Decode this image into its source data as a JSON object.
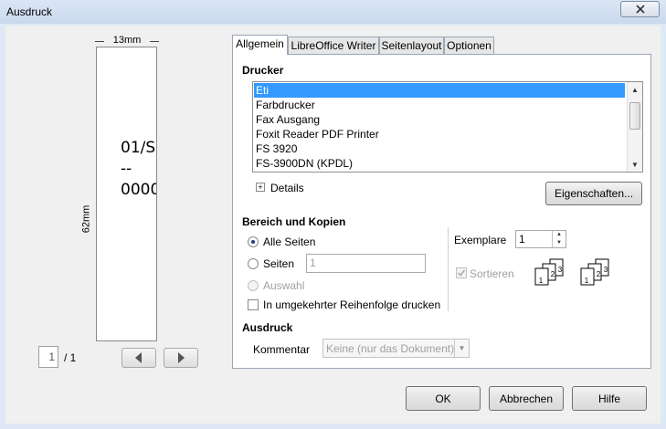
{
  "window": {
    "title": "Ausdruck"
  },
  "preview": {
    "width_label": "13mm",
    "height_label": "62mm",
    "page_lines": [
      "01/S",
      "--",
      "0000"
    ],
    "current_page": "1",
    "total_pages": "/ 1"
  },
  "tabs": [
    "Allgemein",
    "LibreOffice Writer",
    "Seitenlayout",
    "Optionen"
  ],
  "printer": {
    "heading": "Drucker",
    "items": [
      "Eti",
      "Farbdrucker",
      "Fax Ausgang",
      "Foxit Reader PDF Printer",
      "FS 3920",
      "FS-3900DN (KPDL)"
    ],
    "selected": "Eti",
    "details_label": "Details",
    "properties_button": "Eigenschaften..."
  },
  "range": {
    "heading": "Bereich und Kopien",
    "all_pages": "Alle Seiten",
    "pages": "Seiten",
    "pages_value": "1",
    "selection": "Auswahl",
    "reverse": "In umgekehrter Reihenfolge drucken",
    "copies_label": "Exemplare",
    "copies_value": "1",
    "collate": "Sortieren"
  },
  "output": {
    "heading": "Ausdruck",
    "comment_label": "Kommentar",
    "comment_value": "Keine (nur das Dokument)"
  },
  "buttons": {
    "ok": "OK",
    "cancel": "Abbrechen",
    "help": "Hilfe"
  },
  "colors": {
    "selection": "#3399ff",
    "titlebar": "#dbe6f4"
  }
}
